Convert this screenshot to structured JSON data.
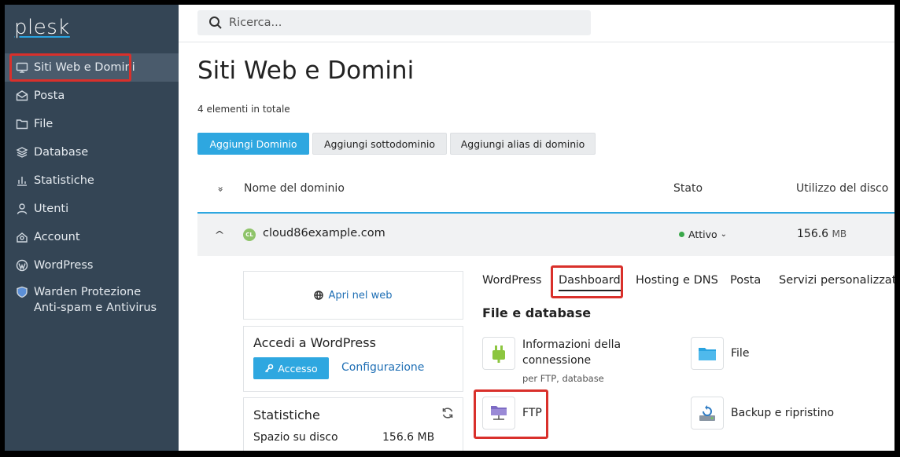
{
  "brand": {
    "logo": "plesk"
  },
  "sidebar": {
    "items": [
      {
        "label": "Siti Web e Domini",
        "icon": "monitor-icon"
      },
      {
        "label": "Posta",
        "icon": "mail-icon"
      },
      {
        "label": "File",
        "icon": "folder-icon"
      },
      {
        "label": "Database",
        "icon": "database-icon"
      },
      {
        "label": "Statistiche",
        "icon": "bar-chart-icon"
      },
      {
        "label": "Utenti",
        "icon": "user-icon"
      },
      {
        "label": "Account",
        "icon": "account-icon"
      },
      {
        "label": "WordPress",
        "icon": "wordpress-icon"
      },
      {
        "label": "Warden Protezione Anti-spam e Antivirus",
        "icon": "shield-icon"
      }
    ],
    "collapse_glyph": "‹"
  },
  "search": {
    "placeholder": "Ricerca..."
  },
  "page": {
    "title": "Siti Web e Domini",
    "count_text": "4 elementi in totale"
  },
  "toolbar": {
    "add_domain": "Aggiungi Dominio",
    "add_subdomain": "Aggiungi sottodominio",
    "add_alias": "Aggiungi alias di dominio"
  },
  "table": {
    "columns": {
      "domain": "Nome del dominio",
      "status": "Stato",
      "disk": "Utilizzo del disco"
    },
    "sort_glyph": "≈",
    "row": {
      "favicon_text": "CL",
      "domain": "cloud86example.com",
      "status": "Attivo",
      "status_caret": "⌄",
      "disk_value": "156.6",
      "disk_unit": "MB",
      "caret": "^"
    }
  },
  "panel": {
    "open_web": "Apri nel web",
    "wp_title": "Accedi a WordPress",
    "wp_access": "Accesso",
    "wp_config": "Configurazione",
    "stats_title": "Statistiche",
    "stats_disk_label": "Spazio su disco",
    "stats_disk_value": "156.6 MB"
  },
  "tabs": [
    "WordPress",
    "Dashboard",
    "Hosting e DNS",
    "Posta",
    "Servizi personalizzati"
  ],
  "section": {
    "title": "File e database",
    "tiles": {
      "conn_info": "Informazioni della connessione",
      "conn_sub": "per FTP, database",
      "file": "File",
      "ftp": "FTP",
      "backup": "Backup e ripristino"
    }
  },
  "colors": {
    "sidebar": "#344555",
    "accent": "#2ea7e0",
    "highlight": "#d9302b"
  }
}
